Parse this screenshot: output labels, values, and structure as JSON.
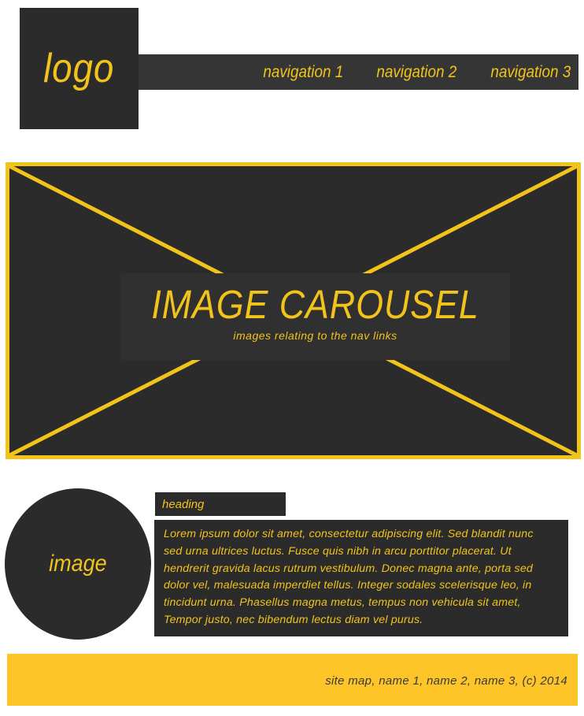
{
  "header": {
    "logo": "logo",
    "nav": [
      "navigation 1",
      "navigation 2",
      "navigation 3"
    ]
  },
  "carousel": {
    "title": "IMAGE CAROUSEL",
    "subtitle": "images relating to the nav links"
  },
  "content": {
    "image_label": "image",
    "heading": "heading",
    "body_lines": [
      "Lorem ipsum dolor sit amet, consectetur adipiscing elit. Sed blandit nunc",
      "sed urna ultrices luctus. Fusce quis nibh in arcu porttitor placerat. Ut",
      "hendrerit gravida lacus rutrum vestibulum. Donec magna ante, porta sed",
      "dolor vel, malesuada imperdiet tellus. Integer sodales scelerisque leo, in",
      "tincidunt urna. Phasellus magna metus, tempus non vehicula sit amet,",
      "Tempor justo, nec bibendum lectus diam vel purus."
    ]
  },
  "footer": {
    "text": "site map, name 1, name 2, name 3, (c) 2014"
  },
  "colors": {
    "accent": "#f2c31b",
    "dark": "#2b2b2b",
    "footer_bg": "#fdc527"
  }
}
